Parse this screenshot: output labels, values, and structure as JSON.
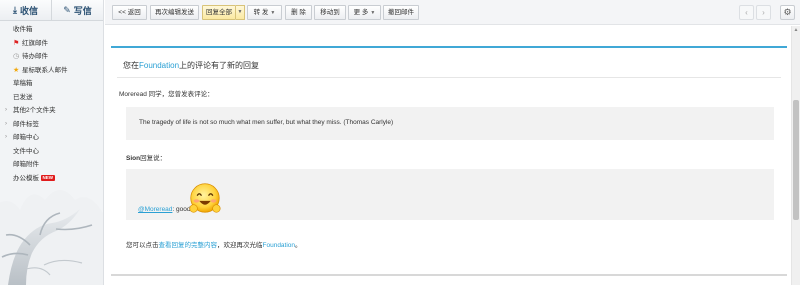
{
  "sidebar": {
    "receive_label": "收信",
    "compose_label": "写信",
    "folders": [
      {
        "label": "收件箱"
      },
      {
        "label": "红旗邮件"
      },
      {
        "label": "待办邮件"
      },
      {
        "label": "星标联系人邮件"
      },
      {
        "label": "草稿箱"
      },
      {
        "label": "已发送"
      },
      {
        "label": "其他2个文件夹"
      },
      {
        "label": "邮件标签"
      },
      {
        "label": "邮箱中心"
      },
      {
        "label": "文件中心"
      },
      {
        "label": "邮箱附件"
      },
      {
        "label": "办公模板",
        "badge": "NEW"
      }
    ],
    "icons": [
      "download-icon",
      "edit-icon",
      "flag-icon",
      "clock-icon",
      "star-icon"
    ]
  },
  "toolbar": {
    "back_label": "<< 返回",
    "resend_label": "再次编辑发送",
    "reply_all_label": "回复全部",
    "forward_label": "转 发",
    "delete_label": "删 除",
    "move_label": "移动到",
    "more_label": "更 多",
    "recall_label": "撤回邮件"
  },
  "mail": {
    "subject_prefix": "您在",
    "subject_link": "Foundation",
    "subject_suffix": "上的评论有了新的回复",
    "greeting": "Moreread 同学，您曾发表评论：",
    "quote": "The tragedy of life is not so much what men suffer, but what they miss. (Thomas Carlyle)",
    "reply_author": "Sion",
    "reply_said": "回复说：",
    "reply_mention": "@Moreread",
    "reply_text": ": good",
    "footer_prefix": "您可以点击",
    "footer_link": "查看回复的完整内容",
    "footer_middle": "，欢迎再次光临",
    "footer_site": "Foundation",
    "footer_end": "。"
  },
  "colors": {
    "accent": "#40a8d6",
    "link": "#2aa0d4",
    "badge": "#e01b1b"
  }
}
